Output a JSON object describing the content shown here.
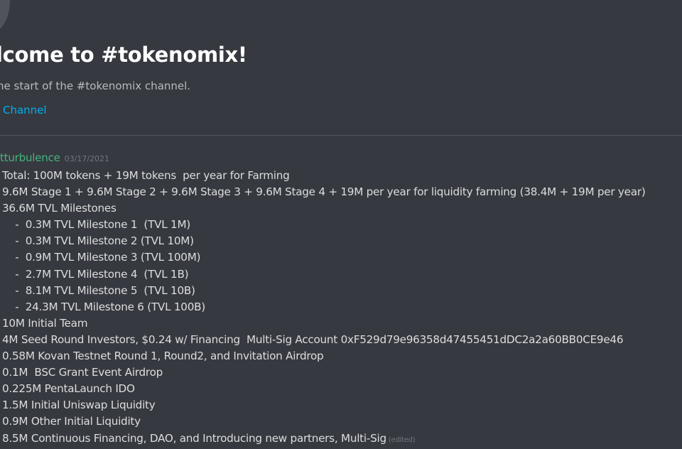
{
  "header": {
    "title": "lcome to #tokenomix!",
    "subtitle": "he start of the #tokenomix channel.",
    "edit_channel": "Channel"
  },
  "message": {
    "author": "tturbulence",
    "timestamp": "03/17/2021",
    "author_color": "#43b581",
    "lines": [
      "Total: 100M tokens + 19M tokens  per year for Farming",
      "9.6M Stage 1 + 9.6M Stage 2 + 9.6M Stage 3 + 9.6M Stage 4 + 19M per year for liquidity farming (38.4M + 19M per year)",
      "36.6M TVL Milestones",
      "    -  0.3M TVL Milestone 1  (TVL 1M)",
      "    -  0.3M TVL Milestone 2 (TVL 10M)",
      "    -  0.9M TVL Milestone 3 (TVL 100M)",
      "    -  2.7M TVL Milestone 4  (TVL 1B)",
      "    -  8.1M TVL Milestone 5  (TVL 10B)",
      "    -  24.3M TVL Milestone 6 (TVL 100B)",
      "10M Initial Team",
      "4M Seed Round Investors, $0.24 w/ Financing  Multi-Sig Account 0xF529d79e96358d47455451dDC2a2a60BB0CE9e46",
      "0.58M Kovan Testnet Round 1, Round2, and Invitation Airdrop",
      "0.1M  BSC Grant Event Airdrop",
      "0.225M PentaLaunch IDO",
      "1.5M Initial Uniswap Liquidity",
      "0.9M Other Initial Liquidity",
      "8.5M Continuous Financing, DAO, and Introducing new partners, Multi-Sig"
    ],
    "edited_label": "(edited)"
  },
  "colors": {
    "background": "#36393f",
    "link": "#00b0f4",
    "text": "#dcddde",
    "muted": "#72767d"
  }
}
